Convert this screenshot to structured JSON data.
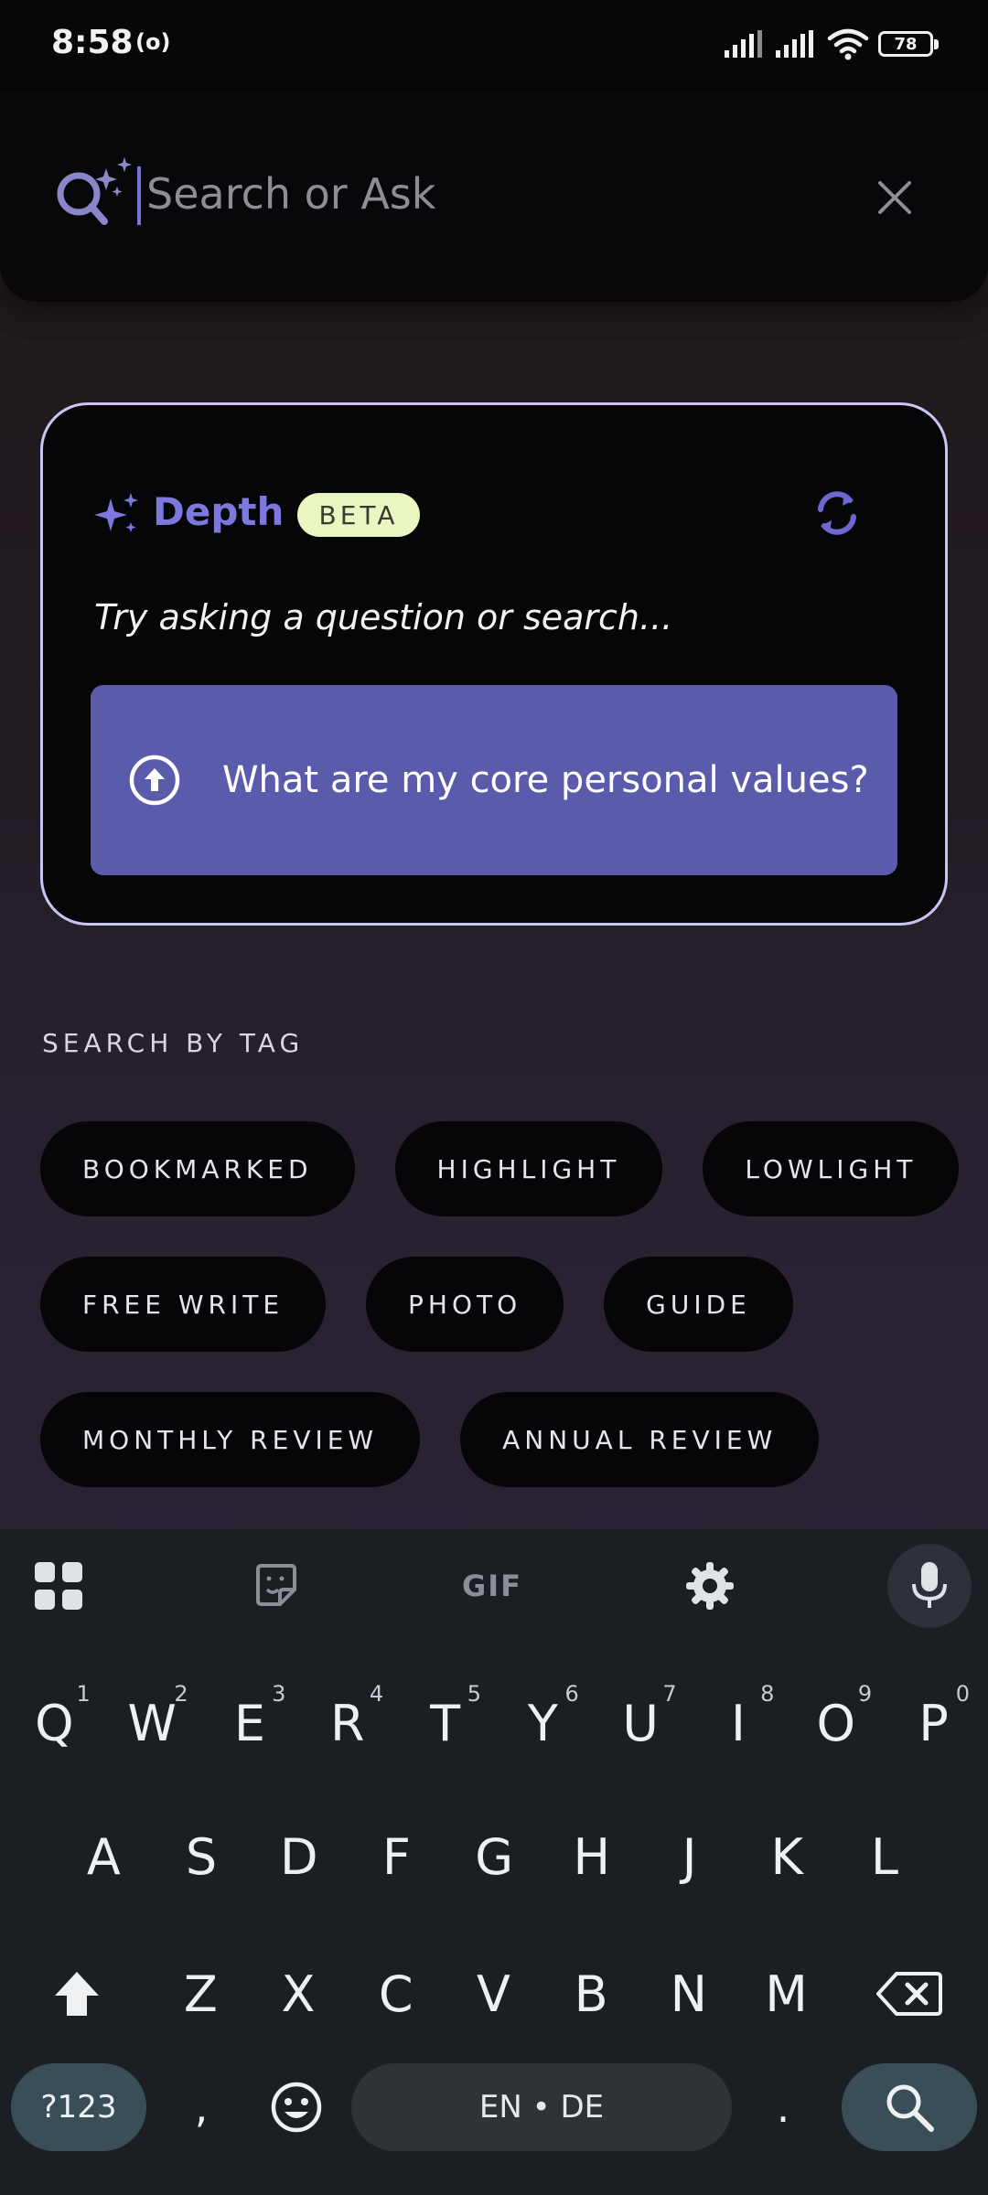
{
  "status_bar": {
    "time": "8:58",
    "hotspot_symbol": "(o)",
    "battery": "78"
  },
  "search": {
    "placeholder": "Search or Ask",
    "icon": "search-sparkle-icon",
    "clear_icon": "close-icon"
  },
  "depth_card": {
    "title": "Depth",
    "badge": "BETA",
    "prompt": "Try asking a question or search...",
    "suggestion": "What are my core personal values?",
    "refresh_icon": "refresh-icon",
    "accent_color": "#7c78de",
    "suggestion_color": "#5a5cab"
  },
  "tags": {
    "heading": "SEARCH BY TAG",
    "rows": [
      [
        "BOOKMARKED",
        "HIGHLIGHT",
        "LOWLIGHT"
      ],
      [
        "FREE WRITE",
        "PHOTO",
        "GUIDE"
      ],
      [
        "MONTHLY REVIEW",
        "ANNUAL REVIEW"
      ]
    ]
  },
  "keyboard": {
    "toolbar": {
      "gif": "GIF"
    },
    "row1": [
      "Q",
      "W",
      "E",
      "R",
      "T",
      "Y",
      "U",
      "I",
      "O",
      "P"
    ],
    "row1_numbers": [
      "1",
      "2",
      "3",
      "4",
      "5",
      "6",
      "7",
      "8",
      "9",
      "0"
    ],
    "row2": [
      "A",
      "S",
      "D",
      "F",
      "G",
      "H",
      "J",
      "K",
      "L"
    ],
    "row3": [
      "Z",
      "X",
      "C",
      "V",
      "B",
      "N",
      "M"
    ],
    "symbols_key": "?123",
    "comma": ",",
    "space_label": "EN • DE",
    "period": "."
  }
}
